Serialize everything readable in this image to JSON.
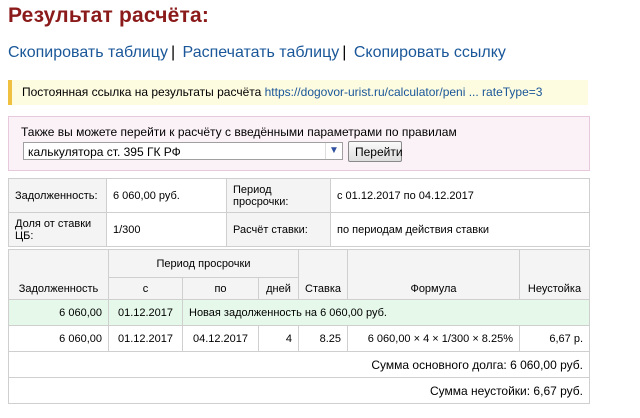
{
  "title": "Результат расчёта:",
  "actions": {
    "copy_table": "Скопировать таблицу",
    "print_table": "Распечатать таблицу",
    "copy_link": "Скопировать ссылку",
    "separator": "|"
  },
  "permalink": {
    "label": "Постоянная ссылка на результаты расчёта",
    "url_text": "https://dogovor-urist.ru/calculator/peni ... rateType=3"
  },
  "rules": {
    "text": "Также вы можете перейти к расчёту с введёнными параметрами по правилам",
    "select_value": "калькулятора ст. 395 ГК РФ",
    "go_label": "Перейти"
  },
  "info": {
    "debt_label": "Задолженность:",
    "debt_value": "6 060,00 руб.",
    "period_label": "Период просрочки:",
    "period_value": "с 01.12.2017 по 04.12.2017",
    "share_label": "Доля от ставки ЦБ:",
    "share_value": "1/300",
    "rate_calc_label": "Расчёт ставки:",
    "rate_calc_value": "по периодам действия ставки"
  },
  "table": {
    "headers": {
      "debt": "Задолженность",
      "period": "Период просрочки",
      "from": "с",
      "to": "по",
      "days": "дней",
      "rate": "Ставка",
      "formula": "Формула",
      "penalty": "Неустойка"
    },
    "new_debt_row": {
      "amount": "6 060,00",
      "date": "01.12.2017",
      "note": "Новая задолженность на 6 060,00 руб."
    },
    "rows": [
      {
        "amount": "6 060,00",
        "from": "01.12.2017",
        "to": "04.12.2017",
        "days": "4",
        "rate": "8.25",
        "formula": "6 060,00 × 4 × 1/300 × 8.25%",
        "penalty": "6,67 р."
      }
    ],
    "principal_sum": "Сумма основного долга: 6 060,00 руб.",
    "penalty_sum": "Сумма неустойки: 6,67 руб."
  },
  "colors": {
    "title": "#8b1a1a",
    "link": "#1a5799",
    "permalink_bg": "#fdfbe0",
    "permalink_border": "#f0c040",
    "rules_bg": "#fbf2f7",
    "new_row_bg": "#e6f8ea"
  },
  "icons": {
    "select_arrow": "chevron-down-icon"
  }
}
